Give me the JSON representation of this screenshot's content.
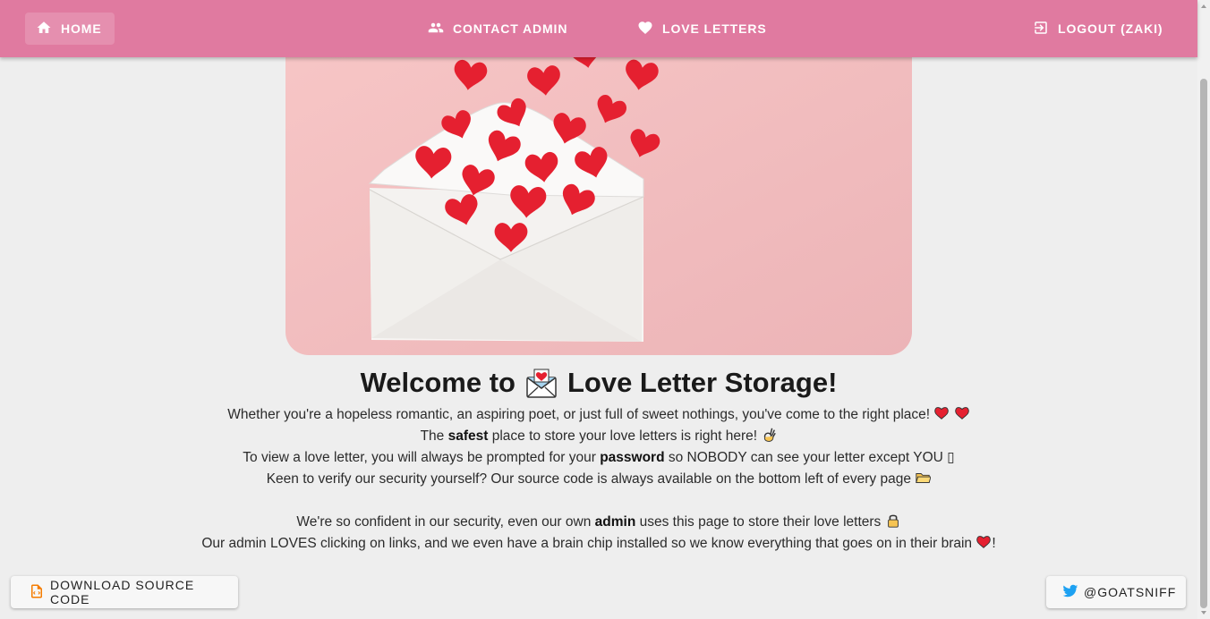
{
  "nav": {
    "home_label": "HOME",
    "contact_label": "CONTACT ADMIN",
    "love_letters_label": "LOVE LETTERS",
    "logout_label": "LOGOUT (ZAKI)",
    "icons": [
      "home-icon",
      "people-icon",
      "heart-icon",
      "logout-icon"
    ]
  },
  "main": {
    "title_prefix": "Welcome to",
    "title_suffix": "Love Letter Storage!",
    "lines": {
      "l1": "Whether you're a hopeless romantic, an aspiring poet, or just full of sweet nothings, you've come to the right place!",
      "l2a": "The",
      "l2b": "safest",
      "l2c": "place to store your love letters is right here!",
      "l3a": "To view a love letter, you will always be prompted for your",
      "l3b": "password",
      "l3c": "so NOBODY can see your letter except YOU",
      "l3d": "▯",
      "l4": "Keen to verify our security yourself? Our source code is always available on the bottom left of every page",
      "l5a": "We're so confident in our security, even our own",
      "l5b": "admin",
      "l5c": "uses this page to store their love letters",
      "l6a": "Our admin LOVES clicking on links, and we even have a brain chip installed so we know everything that goes on in their brain",
      "l6b": "!"
    }
  },
  "footer": {
    "source_label": "DOWNLOAD SOURCE CODE",
    "twitter_label": "@GOATSNIFF"
  },
  "colors": {
    "appbar": "#e07aa0",
    "background": "#eeeeee",
    "heart": "#e8232f",
    "hero_bg": "#f4bfc2"
  }
}
